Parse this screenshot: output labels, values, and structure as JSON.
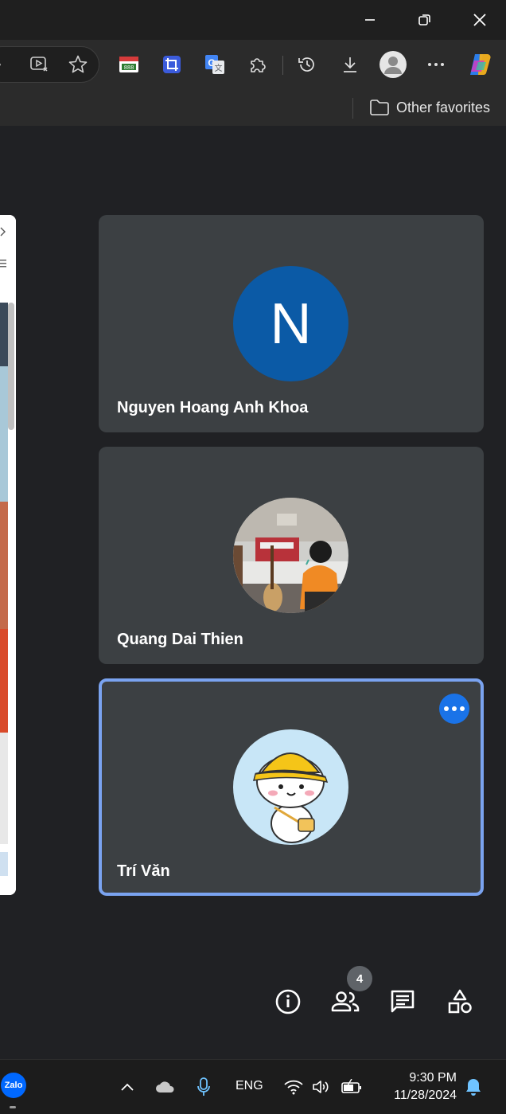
{
  "window_controls": {
    "minimize": "minimize-icon",
    "restore": "restore-icon",
    "close": "close-icon"
  },
  "toolbar": {
    "address_icons": [
      "microphone-icon",
      "read-aloud-icon",
      "favorite-star-icon"
    ],
    "extensions": [
      "extension-counter-icon",
      "crop-extension-icon",
      "google-translate-icon",
      "extensions-puzzle-icon"
    ],
    "right": [
      "history-icon",
      "downloads-icon",
      "profile-avatar-icon",
      "more-menu-icon",
      "copilot-icon"
    ]
  },
  "favorites_bar": {
    "other_favorites_label": "Other favorites"
  },
  "participants": [
    {
      "name": "Nguyen Hoang Anh Khoa",
      "avatar_type": "letter",
      "avatar_letter": "N",
      "avatar_color": "#0b5aa6"
    },
    {
      "name": "Quang Dai Thien",
      "avatar_type": "photo"
    },
    {
      "name": "Trí Văn",
      "avatar_type": "sticker",
      "active_speaker": true
    }
  ],
  "controls": {
    "people_count": "4",
    "buttons": [
      "meeting-info-icon",
      "people-icon",
      "chat-icon",
      "activities-icon"
    ]
  },
  "taskbar": {
    "app": "Zalo",
    "language": "ENG",
    "time": "9:30 PM",
    "date": "11/28/2024",
    "tray_icons": [
      "show-hidden-icons-chevron",
      "onedrive-cloud-icon",
      "microphone-in-use-icon",
      "wifi-icon",
      "volume-icon",
      "battery-charging-icon",
      "notification-bell-icon"
    ]
  },
  "colors": {
    "meet_background": "#202124",
    "tile_background": "#3c4043",
    "active_border": "#7aa3f0",
    "accent_blue": "#1a73e8"
  }
}
